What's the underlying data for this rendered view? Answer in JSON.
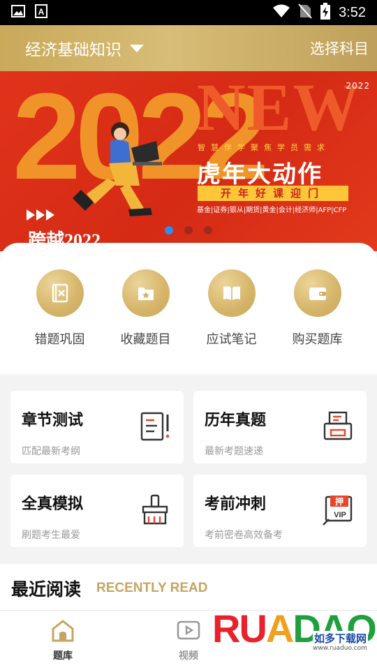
{
  "status_bar": {
    "time": "3:52",
    "left_icons": [
      "image-icon",
      "text-a-icon"
    ],
    "right_icons": [
      "wifi-icon",
      "no-sim-icon",
      "battery-charging-icon"
    ]
  },
  "header": {
    "subject": "经济基础知识",
    "choose_subject": "选择科目",
    "accent": "#c9a95a"
  },
  "banner": {
    "big_year": "2022",
    "new_text": "NEW",
    "year_small": "2022",
    "subline": "智慧伴学聚焦学员需求",
    "main_title": "虎年大动作",
    "tag": "开年好课迎门",
    "categories": "基金|证券|银从|期货|黄金|会计|经济师|AFP|CFP",
    "cross_year": "跨越2022",
    "dots": [
      true,
      false,
      false
    ]
  },
  "quick_actions": [
    {
      "icon": "x-card-icon",
      "label": "错题巩固"
    },
    {
      "icon": "star-folder-icon",
      "label": "收藏题目"
    },
    {
      "icon": "book-icon",
      "label": "应试笔记"
    },
    {
      "icon": "wallet-icon",
      "label": "购买题库"
    }
  ],
  "cards": [
    {
      "title": "章节测试",
      "subtitle": "匹配最新考纲",
      "icon": "notes-exclaim-icon"
    },
    {
      "title": "历年真题",
      "subtitle": "最新考题速递",
      "icon": "printer-icon"
    },
    {
      "title": "全真模拟",
      "subtitle": "刷题考生最爱",
      "icon": "brush-icon"
    },
    {
      "title": "考前冲刺",
      "subtitle": "考前密卷高效备考",
      "icon": "vip-stamp-icon"
    }
  ],
  "recent": {
    "title": "最近阅读",
    "subtitle_en": "RECENTLY READ"
  },
  "bottom_nav": [
    {
      "label": "题库",
      "icon": "home-icon",
      "active": true
    },
    {
      "label": "视频",
      "icon": "video-play-icon",
      "active": false
    }
  ],
  "watermark": {
    "brand": "RUANDAO",
    "chinese": "如多下载网",
    "url": "www.ruaduo.com"
  }
}
